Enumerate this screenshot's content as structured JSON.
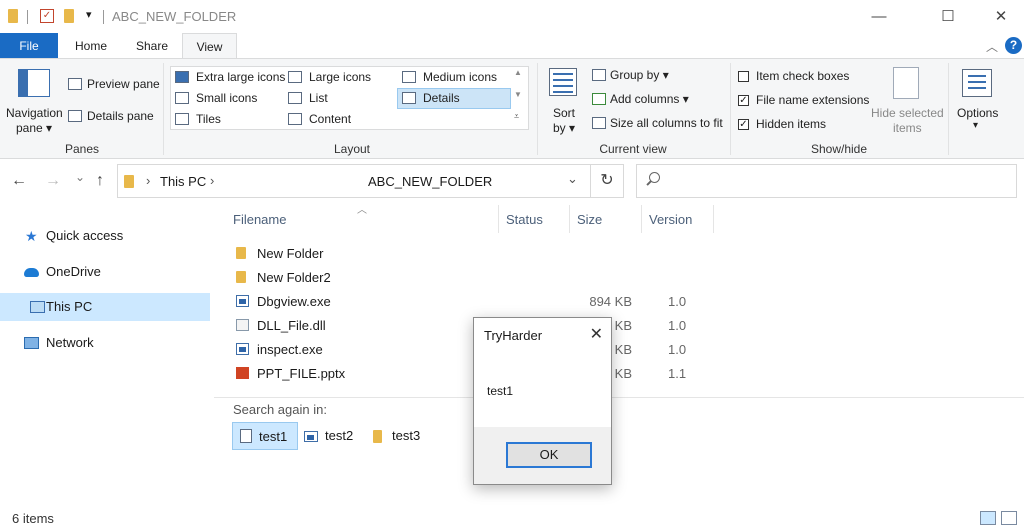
{
  "window": {
    "title": "ABC_NEW_FOLDER",
    "minimize": "—",
    "maximize": "☐",
    "close": "✕",
    "qat_dropdown": "▾"
  },
  "tabs": [
    "File",
    "Home",
    "Share",
    "View"
  ],
  "ribbon": {
    "panes": {
      "navigation_pane": "Navigation",
      "navigation_pane_2": "pane ▾",
      "preview_pane": "Preview pane",
      "details_pane": "Details pane",
      "group_label": "Panes"
    },
    "layout": {
      "extra_large_icons": "Extra large icons",
      "large_icons": "Large icons",
      "medium_icons": "Medium icons",
      "small_icons": "Small icons",
      "list": "List",
      "details": "Details",
      "tiles": "Tiles",
      "content": "Content",
      "group_label": "Layout"
    },
    "current_view": {
      "sort_by": "Sort",
      "sort_by_2": "by ▾",
      "group_by": "Group by ▾",
      "add_columns": "Add columns ▾",
      "size_all_columns": "Size all columns to fit",
      "group_label": "Current view"
    },
    "show_hide": {
      "item_check_boxes": "Item check boxes",
      "file_name_extensions": "File name extensions",
      "hidden_items": "Hidden items",
      "hide_selected_items": "Hide selected",
      "hide_selected_items_2": "items",
      "group_label": "Show/hide",
      "checked": {
        "item_check_boxes": false,
        "file_name_extensions": true,
        "hidden_items": true
      }
    },
    "options": {
      "label": "Options",
      "arrow": "▾"
    }
  },
  "navigation": {
    "back": "←",
    "forward": "→",
    "dropdown": "⌄",
    "up": "↑",
    "breadcrumb_root": "This PC",
    "breadcrumb_sep": "›",
    "breadcrumb_current": "ABC_NEW_FOLDER",
    "address_dropdown": "⌄",
    "refresh": "↻"
  },
  "sidebar": [
    {
      "label": "Quick access"
    },
    {
      "label": "OneDrive"
    },
    {
      "label": "This PC"
    },
    {
      "label": "Network"
    }
  ],
  "columns": [
    "Filename",
    "Status",
    "Size",
    "Version"
  ],
  "files": [
    {
      "name": "New Folder",
      "size": "",
      "version": ""
    },
    {
      "name": "New Folder2",
      "size": "",
      "version": ""
    },
    {
      "name": "Dbgview.exe",
      "size": "894 KB",
      "version": "1.0"
    },
    {
      "name": "DLL_File.dll",
      "size": "KB",
      "version": "1.0"
    },
    {
      "name": "inspect.exe",
      "size": "KB",
      "version": "1.0"
    },
    {
      "name": "PPT_FILE.pptx",
      "size": "KB",
      "version": "1.1"
    }
  ],
  "search_again": {
    "label": "Search again in:",
    "items": [
      "test1",
      "test2",
      "test3"
    ]
  },
  "dialog": {
    "title": "TryHarder",
    "close": "✕",
    "message": "test1",
    "ok": "OK"
  },
  "status": {
    "item_count": "6 items"
  }
}
